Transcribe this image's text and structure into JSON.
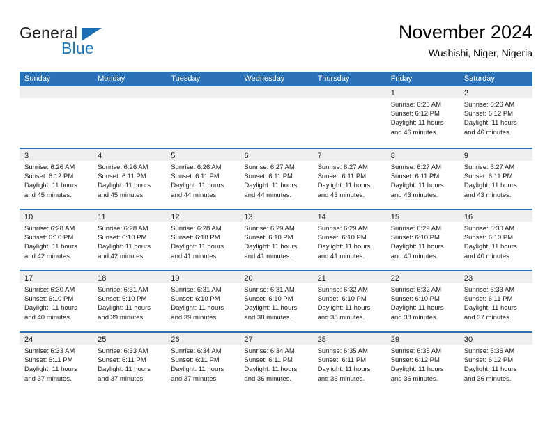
{
  "brand": {
    "name_primary": "General",
    "name_secondary": "Blue",
    "triangle_color": "#1b6fb5",
    "secondary_color": "#1b7ac4"
  },
  "header": {
    "title": "November 2024",
    "subtitle": "Wushishi, Niger, Nigeria"
  },
  "theme": {
    "header_blue": "#2c72b8",
    "day_band_gray": "#efefef",
    "cell_white": "#ffffff",
    "text_black": "#1a1a1a"
  },
  "weekdays": [
    "Sunday",
    "Monday",
    "Tuesday",
    "Wednesday",
    "Thursday",
    "Friday",
    "Saturday"
  ],
  "weeks": [
    [
      {
        "day": "",
        "lines": []
      },
      {
        "day": "",
        "lines": []
      },
      {
        "day": "",
        "lines": []
      },
      {
        "day": "",
        "lines": []
      },
      {
        "day": "",
        "lines": []
      },
      {
        "day": "1",
        "lines": [
          "Sunrise: 6:25 AM",
          "Sunset: 6:12 PM",
          "Daylight: 11 hours",
          "and 46 minutes."
        ]
      },
      {
        "day": "2",
        "lines": [
          "Sunrise: 6:26 AM",
          "Sunset: 6:12 PM",
          "Daylight: 11 hours",
          "and 46 minutes."
        ]
      }
    ],
    [
      {
        "day": "3",
        "lines": [
          "Sunrise: 6:26 AM",
          "Sunset: 6:12 PM",
          "Daylight: 11 hours",
          "and 45 minutes."
        ]
      },
      {
        "day": "4",
        "lines": [
          "Sunrise: 6:26 AM",
          "Sunset: 6:11 PM",
          "Daylight: 11 hours",
          "and 45 minutes."
        ]
      },
      {
        "day": "5",
        "lines": [
          "Sunrise: 6:26 AM",
          "Sunset: 6:11 PM",
          "Daylight: 11 hours",
          "and 44 minutes."
        ]
      },
      {
        "day": "6",
        "lines": [
          "Sunrise: 6:27 AM",
          "Sunset: 6:11 PM",
          "Daylight: 11 hours",
          "and 44 minutes."
        ]
      },
      {
        "day": "7",
        "lines": [
          "Sunrise: 6:27 AM",
          "Sunset: 6:11 PM",
          "Daylight: 11 hours",
          "and 43 minutes."
        ]
      },
      {
        "day": "8",
        "lines": [
          "Sunrise: 6:27 AM",
          "Sunset: 6:11 PM",
          "Daylight: 11 hours",
          "and 43 minutes."
        ]
      },
      {
        "day": "9",
        "lines": [
          "Sunrise: 6:27 AM",
          "Sunset: 6:11 PM",
          "Daylight: 11 hours",
          "and 43 minutes."
        ]
      }
    ],
    [
      {
        "day": "10",
        "lines": [
          "Sunrise: 6:28 AM",
          "Sunset: 6:10 PM",
          "Daylight: 11 hours",
          "and 42 minutes."
        ]
      },
      {
        "day": "11",
        "lines": [
          "Sunrise: 6:28 AM",
          "Sunset: 6:10 PM",
          "Daylight: 11 hours",
          "and 42 minutes."
        ]
      },
      {
        "day": "12",
        "lines": [
          "Sunrise: 6:28 AM",
          "Sunset: 6:10 PM",
          "Daylight: 11 hours",
          "and 41 minutes."
        ]
      },
      {
        "day": "13",
        "lines": [
          "Sunrise: 6:29 AM",
          "Sunset: 6:10 PM",
          "Daylight: 11 hours",
          "and 41 minutes."
        ]
      },
      {
        "day": "14",
        "lines": [
          "Sunrise: 6:29 AM",
          "Sunset: 6:10 PM",
          "Daylight: 11 hours",
          "and 41 minutes."
        ]
      },
      {
        "day": "15",
        "lines": [
          "Sunrise: 6:29 AM",
          "Sunset: 6:10 PM",
          "Daylight: 11 hours",
          "and 40 minutes."
        ]
      },
      {
        "day": "16",
        "lines": [
          "Sunrise: 6:30 AM",
          "Sunset: 6:10 PM",
          "Daylight: 11 hours",
          "and 40 minutes."
        ]
      }
    ],
    [
      {
        "day": "17",
        "lines": [
          "Sunrise: 6:30 AM",
          "Sunset: 6:10 PM",
          "Daylight: 11 hours",
          "and 40 minutes."
        ]
      },
      {
        "day": "18",
        "lines": [
          "Sunrise: 6:31 AM",
          "Sunset: 6:10 PM",
          "Daylight: 11 hours",
          "and 39 minutes."
        ]
      },
      {
        "day": "19",
        "lines": [
          "Sunrise: 6:31 AM",
          "Sunset: 6:10 PM",
          "Daylight: 11 hours",
          "and 39 minutes."
        ]
      },
      {
        "day": "20",
        "lines": [
          "Sunrise: 6:31 AM",
          "Sunset: 6:10 PM",
          "Daylight: 11 hours",
          "and 38 minutes."
        ]
      },
      {
        "day": "21",
        "lines": [
          "Sunrise: 6:32 AM",
          "Sunset: 6:10 PM",
          "Daylight: 11 hours",
          "and 38 minutes."
        ]
      },
      {
        "day": "22",
        "lines": [
          "Sunrise: 6:32 AM",
          "Sunset: 6:10 PM",
          "Daylight: 11 hours",
          "and 38 minutes."
        ]
      },
      {
        "day": "23",
        "lines": [
          "Sunrise: 6:33 AM",
          "Sunset: 6:11 PM",
          "Daylight: 11 hours",
          "and 37 minutes."
        ]
      }
    ],
    [
      {
        "day": "24",
        "lines": [
          "Sunrise: 6:33 AM",
          "Sunset: 6:11 PM",
          "Daylight: 11 hours",
          "and 37 minutes."
        ]
      },
      {
        "day": "25",
        "lines": [
          "Sunrise: 6:33 AM",
          "Sunset: 6:11 PM",
          "Daylight: 11 hours",
          "and 37 minutes."
        ]
      },
      {
        "day": "26",
        "lines": [
          "Sunrise: 6:34 AM",
          "Sunset: 6:11 PM",
          "Daylight: 11 hours",
          "and 37 minutes."
        ]
      },
      {
        "day": "27",
        "lines": [
          "Sunrise: 6:34 AM",
          "Sunset: 6:11 PM",
          "Daylight: 11 hours",
          "and 36 minutes."
        ]
      },
      {
        "day": "28",
        "lines": [
          "Sunrise: 6:35 AM",
          "Sunset: 6:11 PM",
          "Daylight: 11 hours",
          "and 36 minutes."
        ]
      },
      {
        "day": "29",
        "lines": [
          "Sunrise: 6:35 AM",
          "Sunset: 6:12 PM",
          "Daylight: 11 hours",
          "and 36 minutes."
        ]
      },
      {
        "day": "30",
        "lines": [
          "Sunrise: 6:36 AM",
          "Sunset: 6:12 PM",
          "Daylight: 11 hours",
          "and 36 minutes."
        ]
      }
    ]
  ]
}
